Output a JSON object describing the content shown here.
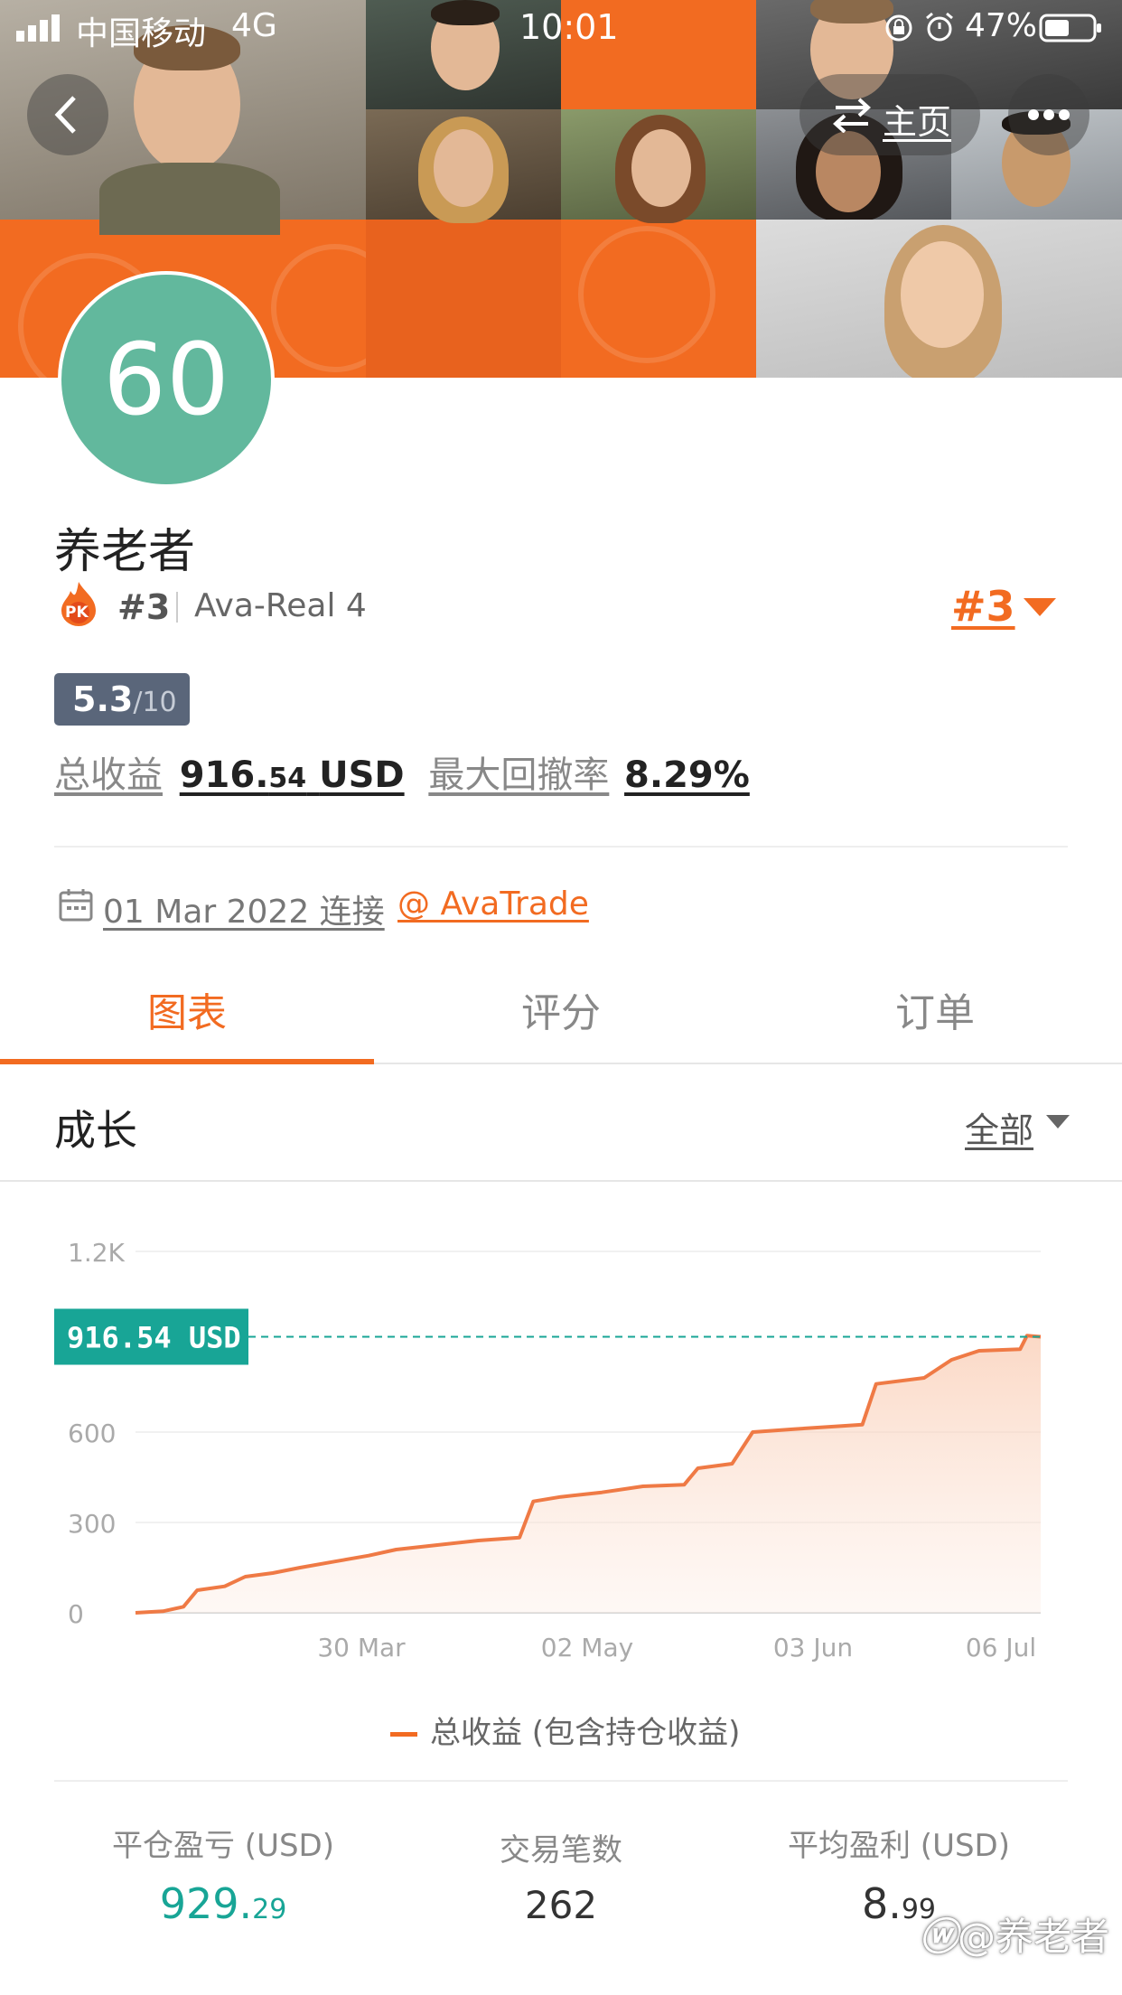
{
  "status_bar": {
    "carrier": "中国移动",
    "network": "4G",
    "time": "10:01",
    "battery": "47%"
  },
  "header": {
    "home_label": "主页"
  },
  "profile": {
    "avatar_number": "60",
    "name": "养老者",
    "pk_badge": "PK",
    "rank": "#3",
    "account": "Ava-Real 4",
    "rank_dropdown": "#3",
    "score": "5.3",
    "score_max": "/10",
    "total_profit_label": "总收益",
    "total_profit_int": "916.",
    "total_profit_dec": "54",
    "total_profit_unit": "USD",
    "max_drawdown_label": "最大回撤率",
    "max_drawdown_value": "8.29%",
    "connect_date": "01 Mar 2022 连接",
    "broker": "@ AvaTrade"
  },
  "tabs": [
    {
      "label": "图表",
      "active": true
    },
    {
      "label": "评分",
      "active": false
    },
    {
      "label": "订单",
      "active": false
    }
  ],
  "growth": {
    "title": "成长",
    "filter": "全部"
  },
  "chart_data": {
    "type": "area",
    "current_label": "916.54 USD",
    "current_value": 916.54,
    "y_ticks": [
      "1.2K",
      "600",
      "300",
      "0"
    ],
    "x_ticks": [
      "30 Mar",
      "02 May",
      "03 Jun",
      "06 Jul"
    ],
    "ylim": [
      0,
      1200
    ],
    "legend": "总收益 (包含持仓收益)",
    "series": [
      {
        "name": "总收益 (包含持仓收益)",
        "points": [
          [
            "2022-03-01",
            0
          ],
          [
            "2022-03-05",
            5
          ],
          [
            "2022-03-08",
            20
          ],
          [
            "2022-03-10",
            75
          ],
          [
            "2022-03-14",
            88
          ],
          [
            "2022-03-17",
            120
          ],
          [
            "2022-03-21",
            132
          ],
          [
            "2022-03-25",
            150
          ],
          [
            "2022-03-30",
            170
          ],
          [
            "2022-04-04",
            190
          ],
          [
            "2022-04-08",
            210
          ],
          [
            "2022-04-14",
            225
          ],
          [
            "2022-04-20",
            240
          ],
          [
            "2022-04-26",
            250
          ],
          [
            "2022-04-28",
            370
          ],
          [
            "2022-05-02",
            385
          ],
          [
            "2022-05-08",
            400
          ],
          [
            "2022-05-14",
            420
          ],
          [
            "2022-05-20",
            425
          ],
          [
            "2022-05-22",
            480
          ],
          [
            "2022-05-27",
            495
          ],
          [
            "2022-05-30",
            600
          ],
          [
            "2022-06-05",
            610
          ],
          [
            "2022-06-12",
            620
          ],
          [
            "2022-06-15",
            625
          ],
          [
            "2022-06-17",
            760
          ],
          [
            "2022-06-24",
            780
          ],
          [
            "2022-06-28",
            840
          ],
          [
            "2022-07-02",
            870
          ],
          [
            "2022-07-08",
            875
          ],
          [
            "2022-07-09",
            920
          ],
          [
            "2022-07-11",
            916.54
          ]
        ]
      }
    ]
  },
  "stats": [
    {
      "label": "平仓盈亏 (USD)",
      "int": "929.",
      "dec": "29"
    },
    {
      "label": "交易笔数",
      "int": "262",
      "dec": ""
    },
    {
      "label": "平均盈利 (USD)",
      "int": "8.",
      "dec": "99"
    }
  ],
  "watermark": "@养老者",
  "colors": {
    "accent": "#f26b21",
    "teal": "#18a596",
    "score_bg": "#5a667a",
    "avatar": "#62b89d"
  }
}
